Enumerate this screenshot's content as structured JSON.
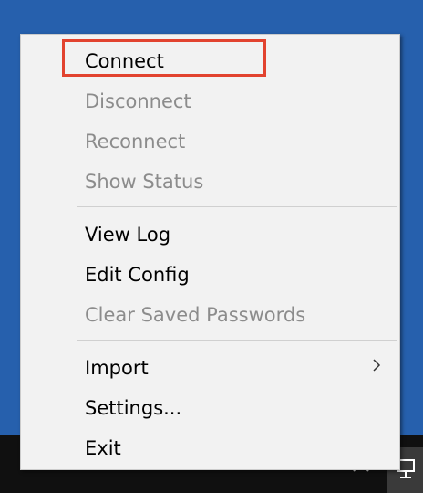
{
  "menu": {
    "items": [
      {
        "label": "Connect",
        "enabled": true
      },
      {
        "label": "Disconnect",
        "enabled": false
      },
      {
        "label": "Reconnect",
        "enabled": false
      },
      {
        "label": "Show Status",
        "enabled": false
      },
      {
        "label": "View Log",
        "enabled": true
      },
      {
        "label": "Edit Config",
        "enabled": true
      },
      {
        "label": "Clear Saved Passwords",
        "enabled": false
      },
      {
        "label": "Import",
        "enabled": true,
        "has_submenu": true
      },
      {
        "label": "Settings...",
        "enabled": true
      },
      {
        "label": "Exit",
        "enabled": true
      }
    ]
  },
  "colors": {
    "desktop": "#2660ad",
    "menu_bg": "#f2f2f2",
    "disabled_text": "#8c8c8c",
    "highlight": "#e2432f",
    "taskbar": "#101010"
  },
  "icons": {
    "submenu": "chevron-right-icon",
    "tray": [
      "language-icon",
      "chevron-up-icon",
      "network-icon"
    ]
  }
}
